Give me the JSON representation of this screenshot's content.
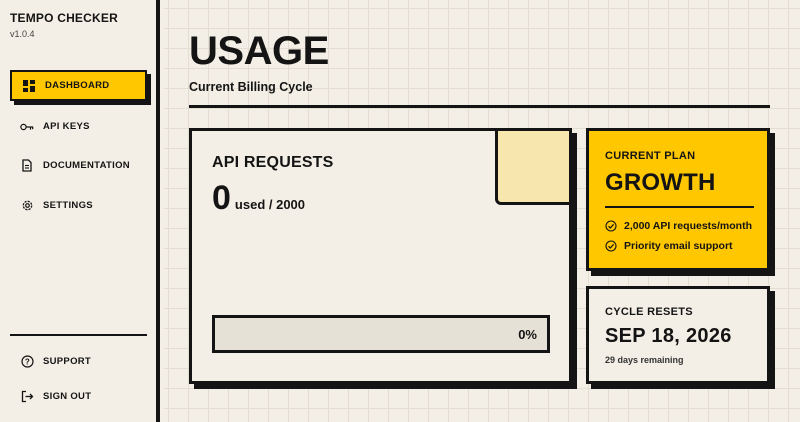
{
  "app": {
    "title": "TEMPO CHECKER",
    "version": "v1.0.4"
  },
  "sidebar": {
    "items": [
      {
        "label": "DASHBOARD",
        "icon": "dashboard-icon",
        "active": true
      },
      {
        "label": "API KEYS",
        "icon": "key-icon"
      },
      {
        "label": "DOCUMENTATION",
        "icon": "document-icon"
      },
      {
        "label": "SETTINGS",
        "icon": "gear-icon"
      }
    ],
    "footer": [
      {
        "label": "SUPPORT",
        "icon": "help-circle-icon"
      },
      {
        "label": "SIGN OUT",
        "icon": "sign-out-icon"
      }
    ]
  },
  "page": {
    "title": "USAGE",
    "subtitle": "Current Billing Cycle"
  },
  "requests": {
    "title": "API REQUESTS",
    "used": "0",
    "of_text": "used / 2000",
    "progress_percent": 0,
    "progress_label": "0%"
  },
  "plan": {
    "label": "CURRENT PLAN",
    "name": "GROWTH",
    "features": [
      "2,000 API requests/month",
      "Priority email support"
    ]
  },
  "cycle": {
    "label": "CYCLE RESETS",
    "date": "SEP 18, 2026",
    "remaining": "29 days remaining"
  },
  "colors": {
    "accent": "#ffc700",
    "ink": "#141414",
    "background": "#f4efe6",
    "soft_yellow": "#f7e6ad"
  }
}
